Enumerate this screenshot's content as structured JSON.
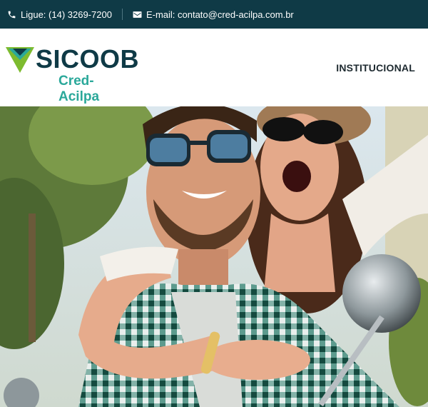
{
  "topbar": {
    "phone_text": "Ligue: (14) 3269-7200",
    "email_text": "E-mail: contato@cred-acilpa.com.br"
  },
  "logo": {
    "name": "SICOOB",
    "subname": "Cred-Acilpa"
  },
  "nav": {
    "items": [
      {
        "label": "INSTITUCIONAL"
      }
    ]
  },
  "hero": {
    "image": "couple-on-scooter-photo"
  },
  "colors": {
    "topbar_bg": "#0f3a46",
    "brand_dark": "#0f3a46",
    "brand_teal": "#2aa89a",
    "brand_green": "#7dbb2f"
  }
}
